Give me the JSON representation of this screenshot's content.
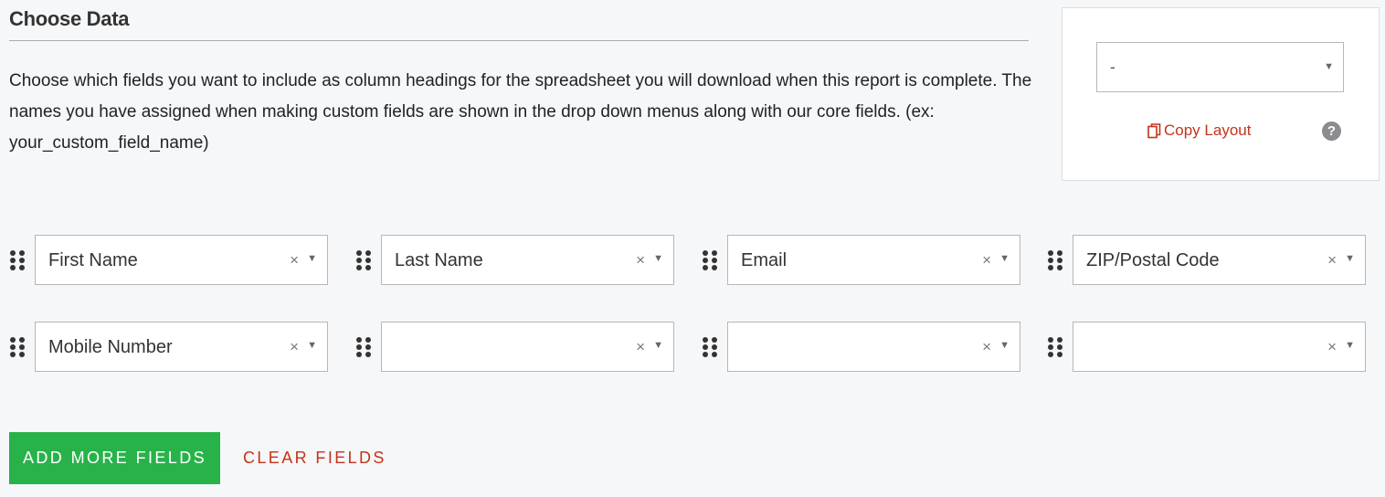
{
  "section": {
    "title": "Choose Data",
    "description": "Choose which fields you want to include as column headings for the spreadsheet you will download when this report is complete. The names you have assigned when making custom fields are shown in the drop down menus along with our core fields. (ex: your_custom_field_name)"
  },
  "layout_panel": {
    "select_value": "-",
    "copy_label": "Copy Layout",
    "help_symbol": "?"
  },
  "fields": [
    {
      "value": "First Name"
    },
    {
      "value": "Last Name"
    },
    {
      "value": "Email"
    },
    {
      "value": "ZIP/Postal Code"
    },
    {
      "value": "Mobile Number"
    },
    {
      "value": ""
    },
    {
      "value": ""
    },
    {
      "value": ""
    }
  ],
  "symbols": {
    "clear": "×",
    "caret": "▼"
  },
  "actions": {
    "add_label": "ADD MORE FIELDS",
    "clear_label": "CLEAR FIELDS"
  },
  "colors": {
    "accent_green": "#28b34a",
    "accent_red": "#c4331a",
    "background": "#f6f7f9"
  },
  "icons": {
    "drag": "drag-handle-icon",
    "copy": "copy-icon",
    "help": "help-icon"
  }
}
